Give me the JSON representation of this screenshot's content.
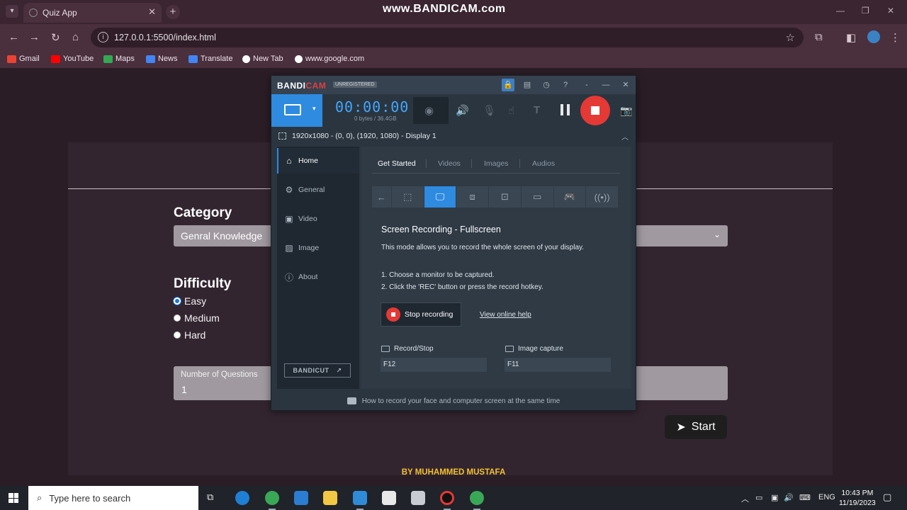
{
  "browser": {
    "tab_title": "Quiz App",
    "watermark": "www.BANDICAM.com",
    "url": "127.0.0.1:5500/index.html",
    "bookmarks": [
      {
        "label": "Gmail",
        "color": "#ea4335"
      },
      {
        "label": "YouTube",
        "color": "#ff0000"
      },
      {
        "label": "Maps",
        "color": "#34a853"
      },
      {
        "label": "News",
        "color": "#4285f4"
      },
      {
        "label": "Translate",
        "color": "#4285f4"
      },
      {
        "label": "New Tab",
        "color": "#ffffff"
      },
      {
        "label": "www.google.com",
        "color": "#ffffff"
      }
    ]
  },
  "quiz": {
    "category_label": "Category",
    "category_value": "Genral Knowledge",
    "difficulty_label": "Difficulty",
    "difficulties": [
      "Easy",
      "Medium",
      "Hard"
    ],
    "selected_difficulty": "Easy",
    "questions_label": "Number of Questions",
    "questions_value": "1",
    "start_label": "Start",
    "footer": "BY MUHAMMED MUSTAFA"
  },
  "bandicam": {
    "logo_a": "BANDI",
    "logo_b": "CAM",
    "unregistered": "UNREGISTERED",
    "timer": "00:00:00",
    "bytes": "0 bytes / 36.4GB",
    "target": "1920x1080 - (0, 0), (1920, 1080) - Display 1",
    "nav": [
      "Home",
      "General",
      "Video",
      "Image",
      "About"
    ],
    "bandicut": "BANDICUT",
    "tabs": [
      "Get Started",
      "Videos",
      "Images",
      "Audios"
    ],
    "heading": "Screen Recording - Fullscreen",
    "description": "This mode allows you to record the whole screen of your display.",
    "step1": "1. Choose a monitor to be captured.",
    "step2": "2. Click the 'REC' button or press the record hotkey.",
    "stop_label": "Stop recording",
    "help_link": "View online help",
    "hotkey_record_label": "Record/Stop",
    "hotkey_record_value": "F12",
    "hotkey_image_label": "Image capture",
    "hotkey_image_value": "F11",
    "tip": "How to record your face and computer screen at the same time"
  },
  "taskbar": {
    "search_placeholder": "Type here to search",
    "lang": "ENG",
    "time": "10:43 PM",
    "date": "11/19/2023"
  }
}
